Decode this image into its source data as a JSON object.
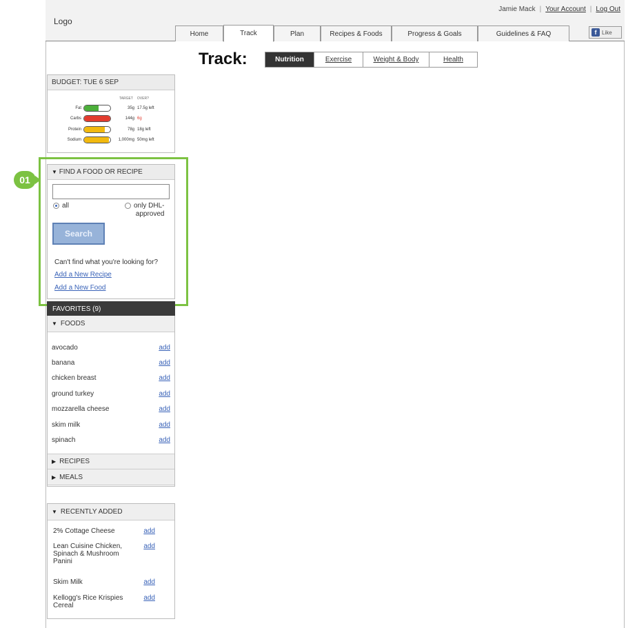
{
  "header": {
    "logo": "Logo",
    "user_name": "Jamie Mack",
    "your_account": "Your Account",
    "log_out": "Log Out",
    "nav": [
      {
        "label": "Home"
      },
      {
        "label": "Track",
        "active": true
      },
      {
        "label": "Plan"
      },
      {
        "label": "Recipes & Foods"
      },
      {
        "label": "Progress & Goals"
      },
      {
        "label": "Guidelines & FAQ"
      }
    ],
    "facebook_like": "Like",
    "facebook_icon": "facebook-icon"
  },
  "track": {
    "title": "Track:",
    "tabs": [
      {
        "label": "Nutrition",
        "active": true
      },
      {
        "label": "Exercise"
      },
      {
        "label": "Weight & Body"
      },
      {
        "label": "Health"
      }
    ]
  },
  "budget": {
    "title": "BUDGET: TUE 6 SEP",
    "col_target": "TARGET",
    "col_over": "OVER?",
    "rows": [
      {
        "label": "Fat",
        "target": "35g",
        "over": "17.5g left",
        "fill": 0.55,
        "color": "#4caf3a"
      },
      {
        "label": "Carbs",
        "target": "144g",
        "over": "6g",
        "fill": 1.0,
        "color": "#e23b2e",
        "over_color": "#e23b2e"
      },
      {
        "label": "Protein",
        "target": "78g",
        "over": "18g left",
        "fill": 0.8,
        "color": "#f2b90f"
      },
      {
        "label": "Sodium",
        "target": "1,000mg",
        "over": "50mg left",
        "fill": 0.95,
        "color": "#f2b90f"
      }
    ]
  },
  "find": {
    "badge": "01",
    "title": "FIND A FOOD OR RECIPE",
    "input_value": "",
    "radio_all": "all",
    "radio_dhl_line1": "only DHL-",
    "radio_dhl_line2": "approved",
    "search_label": "Search",
    "cant_find": "Can't find what you're looking for?",
    "add_recipe": "Add a New Recipe",
    "add_food": "Add a New Food",
    "accent_color": "#7cc242"
  },
  "favorites": {
    "title": "FAVORITES (9)",
    "foods_title": "FOODS",
    "foods": [
      {
        "name": "avocado",
        "action": "add"
      },
      {
        "name": "banana",
        "action": "add"
      },
      {
        "name": "chicken breast",
        "action": "add"
      },
      {
        "name": "ground turkey",
        "action": "add"
      },
      {
        "name": "mozzarella cheese",
        "action": "add"
      },
      {
        "name": "skim milk",
        "action": "add"
      },
      {
        "name": "spinach",
        "action": "add"
      }
    ],
    "recipes_title": "RECIPES",
    "meals_title": "MEALS"
  },
  "recent": {
    "title": "RECENTLY ADDED",
    "items": [
      {
        "name": "2% Cottage Cheese",
        "action": "add"
      },
      {
        "name": "Lean Cuisine Chicken, Spinach & Mushroom Panini",
        "action": "add"
      },
      {
        "name": "Skim Milk",
        "action": "add"
      },
      {
        "name": "Kellogg's Rice Krispies Cereal",
        "action": "add"
      }
    ]
  }
}
